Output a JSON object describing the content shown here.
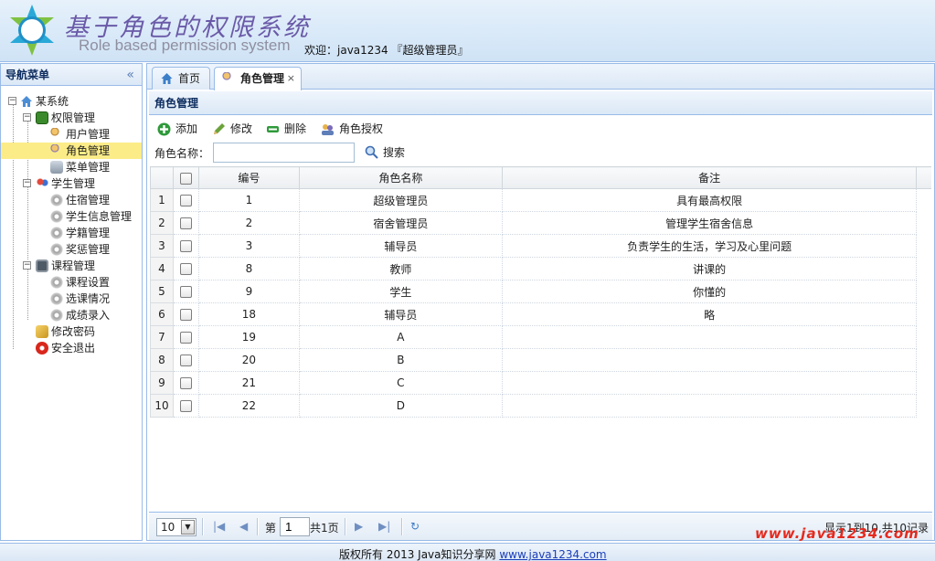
{
  "header": {
    "title_cn": "基于角色的权限系统",
    "title_en": "Role based permission system",
    "welcome": "欢迎：java1234 『超级管理员』"
  },
  "nav": {
    "title": "导航菜单",
    "collapse_icon": "double-chevron-left-icon",
    "tree": [
      {
        "label": "某系统",
        "icon": "home-icon"
      },
      {
        "label": "权限管理",
        "icon": "folder-icon"
      },
      {
        "label": "用户管理",
        "icon": "user-icon"
      },
      {
        "label": "角色管理",
        "icon": "role-icon"
      },
      {
        "label": "菜单管理",
        "icon": "menu-icon"
      },
      {
        "label": "学生管理",
        "icon": "students-icon"
      },
      {
        "label": "住宿管理",
        "icon": "gear-icon"
      },
      {
        "label": "学生信息管理",
        "icon": "gear-icon"
      },
      {
        "label": "学籍管理",
        "icon": "gear-icon"
      },
      {
        "label": "奖惩管理",
        "icon": "gear-icon"
      },
      {
        "label": "课程管理",
        "icon": "monitor-icon"
      },
      {
        "label": "课程设置",
        "icon": "gear-icon"
      },
      {
        "label": "选课情况",
        "icon": "gear-icon"
      },
      {
        "label": "成绩录入",
        "icon": "gear-icon"
      },
      {
        "label": "修改密码",
        "icon": "key-icon"
      },
      {
        "label": "安全退出",
        "icon": "exit-icon"
      }
    ]
  },
  "tabs": [
    {
      "label": "首页",
      "icon": "home-icon"
    },
    {
      "label": "角色管理",
      "icon": "role-icon",
      "close": "×"
    }
  ],
  "panel": {
    "title": "角色管理"
  },
  "toolbar": {
    "add": "添加",
    "edit": "修改",
    "delete": "删除",
    "authorize": "角色授权"
  },
  "search": {
    "label": "角色名称：",
    "value": "",
    "placeholder": "",
    "button": "搜索"
  },
  "grid": {
    "columns": [
      "编号",
      "角色名称",
      "备注"
    ],
    "rows": [
      {
        "rownum": "1",
        "id": "1",
        "name": "超级管理员",
        "remark": "具有最高权限"
      },
      {
        "rownum": "2",
        "id": "2",
        "name": "宿舍管理员",
        "remark": "管理学生宿舍信息"
      },
      {
        "rownum": "3",
        "id": "3",
        "name": "辅导员",
        "remark": "负责学生的生活，学习及心里问题"
      },
      {
        "rownum": "4",
        "id": "8",
        "name": "教师",
        "remark": "讲课的"
      },
      {
        "rownum": "5",
        "id": "9",
        "name": "学生",
        "remark": "你懂的"
      },
      {
        "rownum": "6",
        "id": "18",
        "name": "辅导员",
        "remark": "略"
      },
      {
        "rownum": "7",
        "id": "19",
        "name": "A",
        "remark": ""
      },
      {
        "rownum": "8",
        "id": "20",
        "name": "B",
        "remark": ""
      },
      {
        "rownum": "9",
        "id": "21",
        "name": "C",
        "remark": ""
      },
      {
        "rownum": "10",
        "id": "22",
        "name": "D",
        "remark": ""
      }
    ]
  },
  "pager": {
    "page_size": "10",
    "page_label": "第",
    "page_value": "1",
    "total_pages": "共1页",
    "info": "显示1到10,共10记录"
  },
  "footer": {
    "copyright": "版权所有 2013 Java知识分享网 ",
    "link": "www.java1234.com"
  },
  "watermark": "www.java1234.com",
  "colors": {
    "border": "#99bbe8",
    "selected": "#fbec88",
    "title_purple": "#6a5aa8",
    "watermark_red": "#e52a1e"
  }
}
